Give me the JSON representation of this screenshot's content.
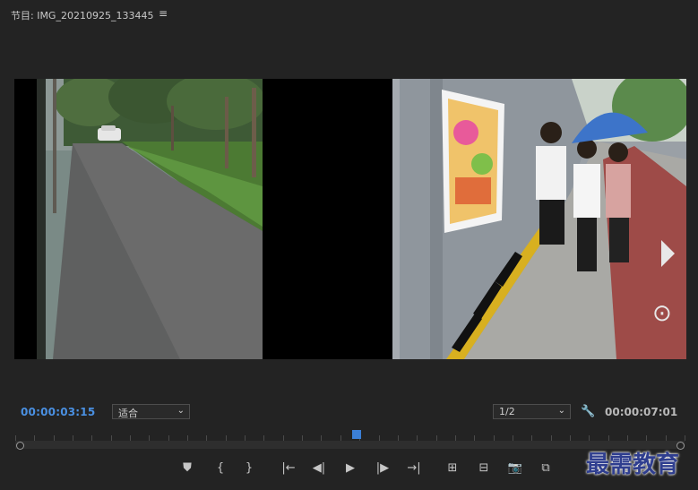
{
  "program": {
    "title": "节目: IMG_20210925_133445",
    "menu_icon": "hamburger-icon"
  },
  "playback": {
    "current_timecode": "00:00:03:15",
    "duration_timecode": "00:00:07:01",
    "zoom_select": "适合",
    "resolution_select": "1/2",
    "playhead_fraction": 0.51
  },
  "transport": {
    "buttons": [
      "add-marker-icon",
      "mark-in-icon",
      "mark-out-icon",
      "go-to-in-icon",
      "step-back-icon",
      "play-icon",
      "step-forward-icon",
      "go-to-out-icon",
      "lift-icon",
      "extract-icon",
      "export-frame-icon",
      "comparison-view-icon"
    ]
  },
  "watermark": {
    "text": "最需教育"
  },
  "colors": {
    "accent": "#3b7fd6",
    "timecode": "#4a90e2"
  }
}
